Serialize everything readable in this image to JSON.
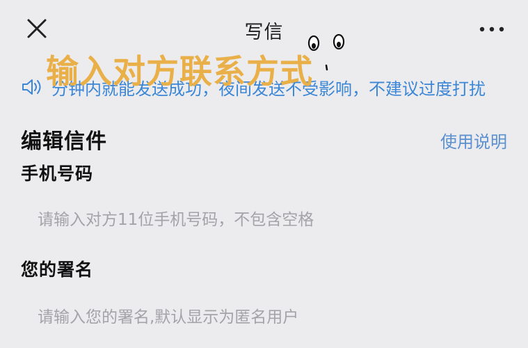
{
  "header": {
    "title": "写信",
    "close_icon": "close-icon",
    "more_icon": "more-icon"
  },
  "overlay": {
    "caption": "输入对方联系方式",
    "caption_color": "#e9b04a",
    "emoji_icon": "eyes-icon"
  },
  "notice": {
    "icon": "speaker-icon",
    "text": "分钟内就能发送成功，夜间发送不受影响，不建议过度打扰"
  },
  "editor": {
    "section_title": "编辑信件",
    "help_link": "使用说明",
    "phone": {
      "label": "手机号码",
      "value": "",
      "placeholder": "请输入对方11位手机号码，不包含空格"
    },
    "signature": {
      "label": "您的署名",
      "value": "",
      "placeholder": "请输入您的署名,默认显示为匿名用户"
    }
  },
  "colors": {
    "background": "#ececee",
    "accent_link": "#5a8fd0",
    "notice_text": "#3b86d6"
  }
}
